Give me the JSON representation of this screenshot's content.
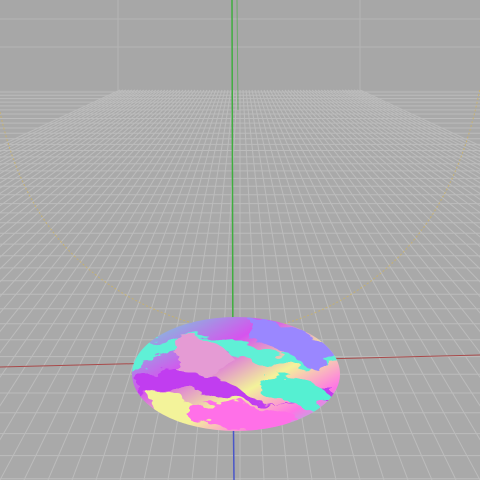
{
  "viewport": {
    "mode": "3d-perspective",
    "background_color": "#a7a7a7",
    "floor_color": "#a9a9a9",
    "grid_line_color": "#bcbcbc",
    "axis_colors": {
      "x": "#a94a4a",
      "y": "#3fae3f",
      "z": "#4a56c8"
    },
    "orbit_guide_color": "#d2b45a",
    "grid_visible": true
  },
  "scene_objects": [
    {
      "name": "disc-mesh",
      "material": "holographic-marble",
      "colors": [
        "#55f0d2",
        "#ff6fe8",
        "#c13ef0",
        "#f3f39a",
        "#9a87ff",
        "#e59bd4"
      ]
    }
  ]
}
